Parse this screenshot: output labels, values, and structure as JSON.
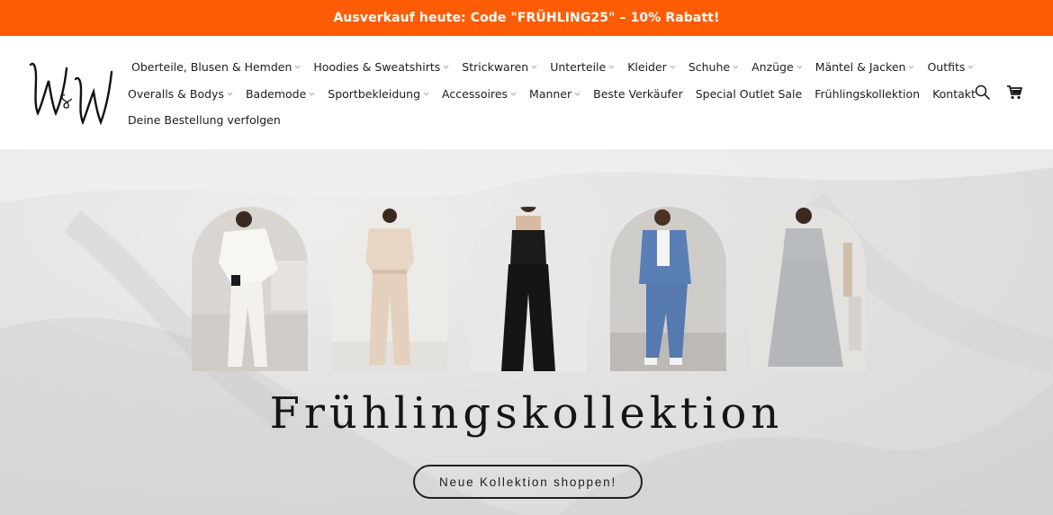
{
  "announcement": "Ausverkauf heute: Code \"FRÜHLING25\" – 10% Rabatt!",
  "logo": {
    "text": "W&W"
  },
  "nav": {
    "row1": [
      {
        "label": "Oberteile, Blusen & Hemden",
        "dropdown": true
      },
      {
        "label": "Hoodies & Sweatshirts",
        "dropdown": true
      },
      {
        "label": "Strickwaren",
        "dropdown": true
      },
      {
        "label": "Unterteile",
        "dropdown": true
      },
      {
        "label": "Kleider",
        "dropdown": true
      },
      {
        "label": "Schuhe",
        "dropdown": true
      },
      {
        "label": "Anzüge",
        "dropdown": true
      },
      {
        "label": "Mäntel & Jacken",
        "dropdown": true
      },
      {
        "label": "Outfits",
        "dropdown": true
      }
    ],
    "row2": [
      {
        "label": "Overalls & Bodys",
        "dropdown": true
      },
      {
        "label": "Bademode",
        "dropdown": true
      },
      {
        "label": "Sportbekleidung",
        "dropdown": true
      },
      {
        "label": "Accessoires",
        "dropdown": true
      },
      {
        "label": "Manner",
        "dropdown": true
      },
      {
        "label": "Beste Verkäufer",
        "dropdown": false
      },
      {
        "label": "Special Outlet Sale",
        "dropdown": false
      },
      {
        "label": "Frühlingskollektion",
        "dropdown": false
      },
      {
        "label": "Kontakt",
        "dropdown": false
      }
    ],
    "row3": [
      {
        "label": "Deine Bestellung verfolgen",
        "dropdown": false
      }
    ]
  },
  "header_icons": [
    "search-icon",
    "cart-icon"
  ],
  "hero": {
    "title": "Frühlingskollektion",
    "cta": "Neue Kollektion shoppen!"
  },
  "colors": {
    "announcement_bg": "#ff5d05",
    "text": "#1a1a1a"
  }
}
